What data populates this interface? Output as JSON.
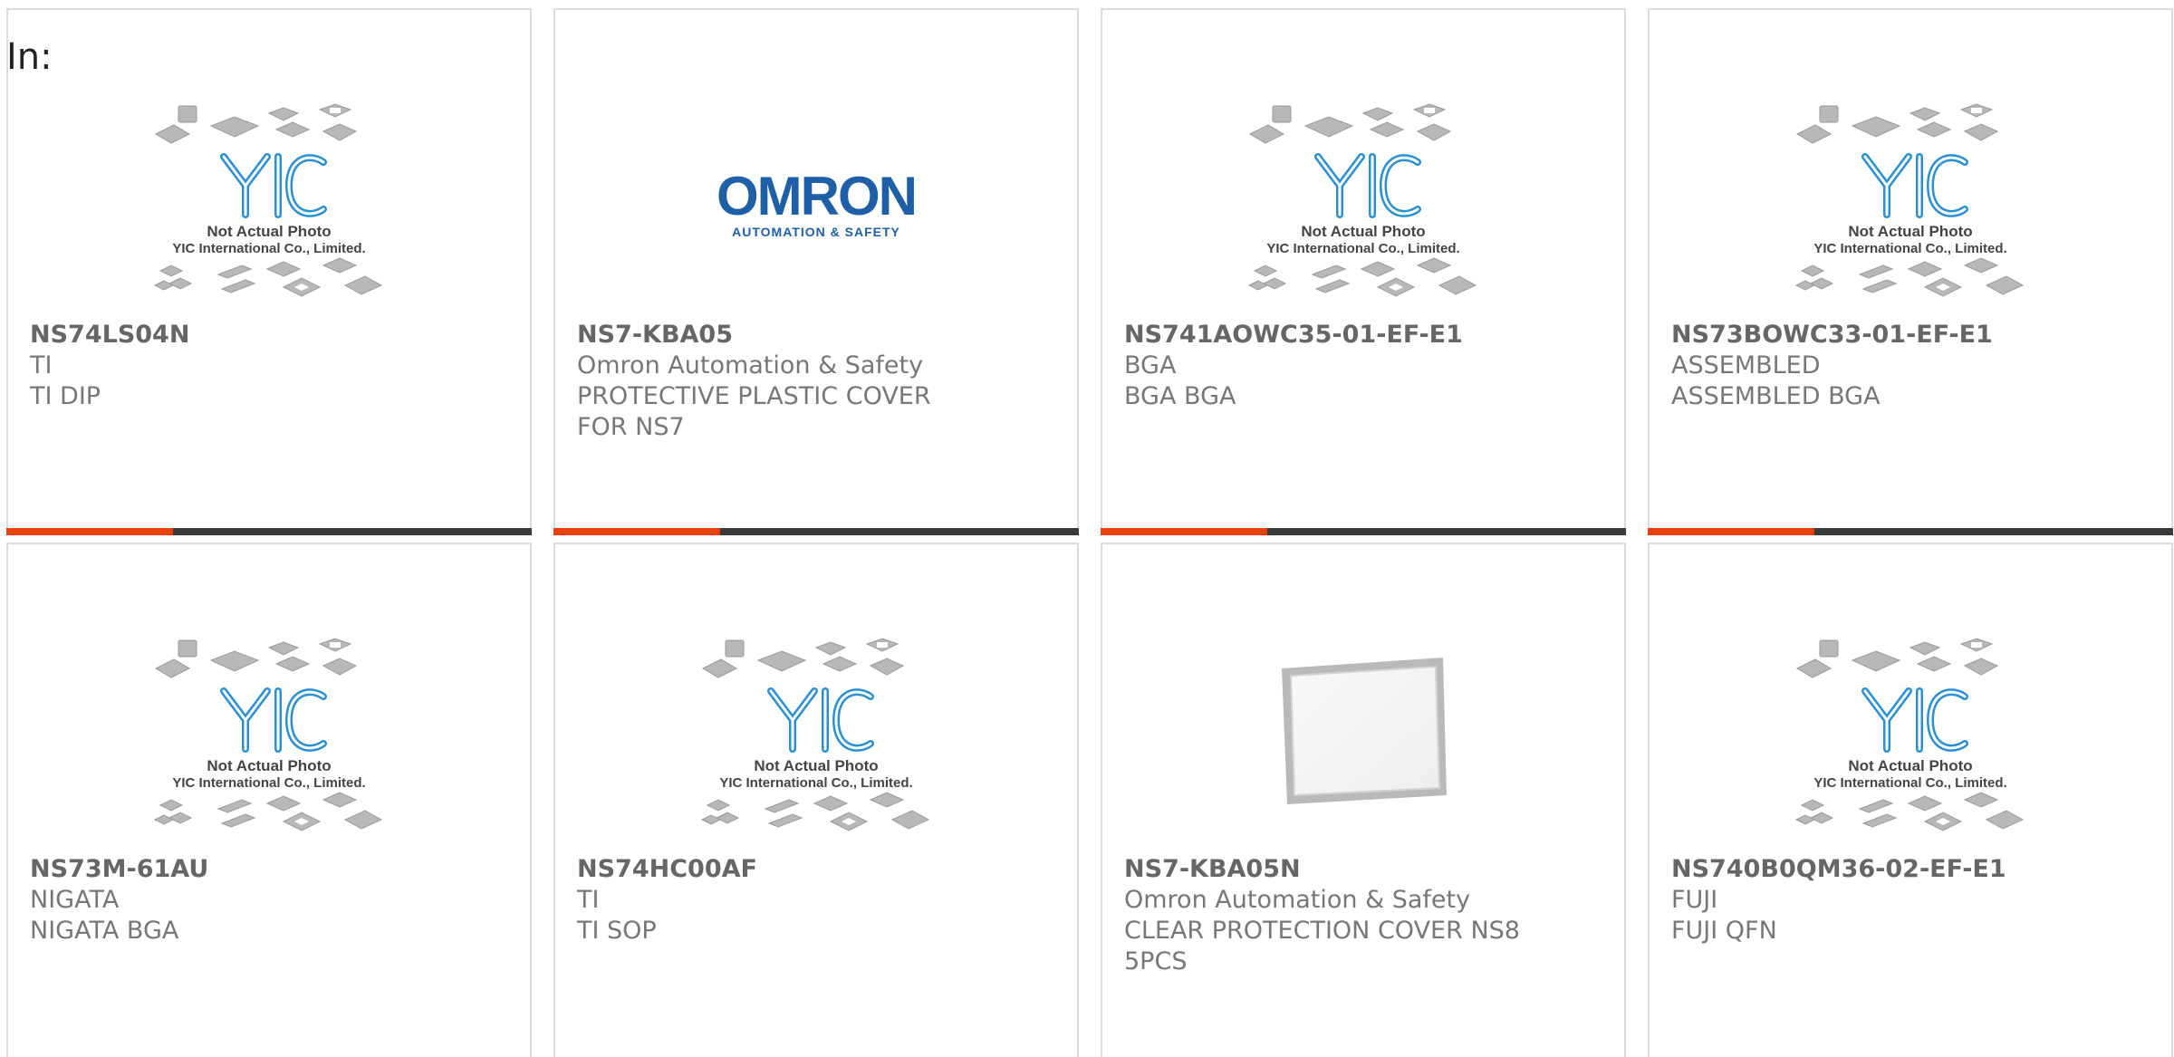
{
  "filter": {
    "label": "In:"
  },
  "colors": {
    "accent": "#e8420c",
    "bar": "#3a3a3a",
    "omron_blue": "#1f5fa8",
    "yic_blue": "#2a8fd0",
    "text": "#777777"
  },
  "placeholder": {
    "caption1": "Not Actual Photo",
    "caption2": "YIC International Co., Limited.",
    "logo": "YIC"
  },
  "omron_logo": {
    "name": "OMRON",
    "tagline": "AUTOMATION & SAFETY"
  },
  "products": [
    {
      "part": "NS74LS04N",
      "lines": [
        "TI",
        "TI DIP"
      ],
      "image": "yic-placeholder"
    },
    {
      "part": "NS7-KBA05",
      "lines": [
        "Omron Automation & Safety",
        "PROTECTIVE PLASTIC COVER",
        "FOR NS7"
      ],
      "image": "omron-logo"
    },
    {
      "part": "NS741AOWC35-01-EF-E1",
      "lines": [
        "BGA",
        "BGA BGA"
      ],
      "image": "yic-placeholder"
    },
    {
      "part": "NS73BOWC33-01-EF-E1",
      "lines": [
        "ASSEMBLED",
        "ASSEMBLED BGA"
      ],
      "image": "yic-placeholder"
    },
    {
      "part": "NS73M-61AU",
      "lines": [
        "NIGATA",
        "NIGATA BGA"
      ],
      "image": "yic-placeholder"
    },
    {
      "part": "NS74HC00AF",
      "lines": [
        "TI",
        "TI SOP"
      ],
      "image": "yic-placeholder"
    },
    {
      "part": "NS7-KBA05N",
      "lines": [
        "Omron Automation & Safety",
        "CLEAR PROTECTION COVER NS8",
        "5PCS"
      ],
      "image": "cover-photo"
    },
    {
      "part": "NS740B0QM36-02-EF-E1",
      "lines": [
        "FUJI",
        "FUJI QFN"
      ],
      "image": "yic-placeholder"
    }
  ]
}
